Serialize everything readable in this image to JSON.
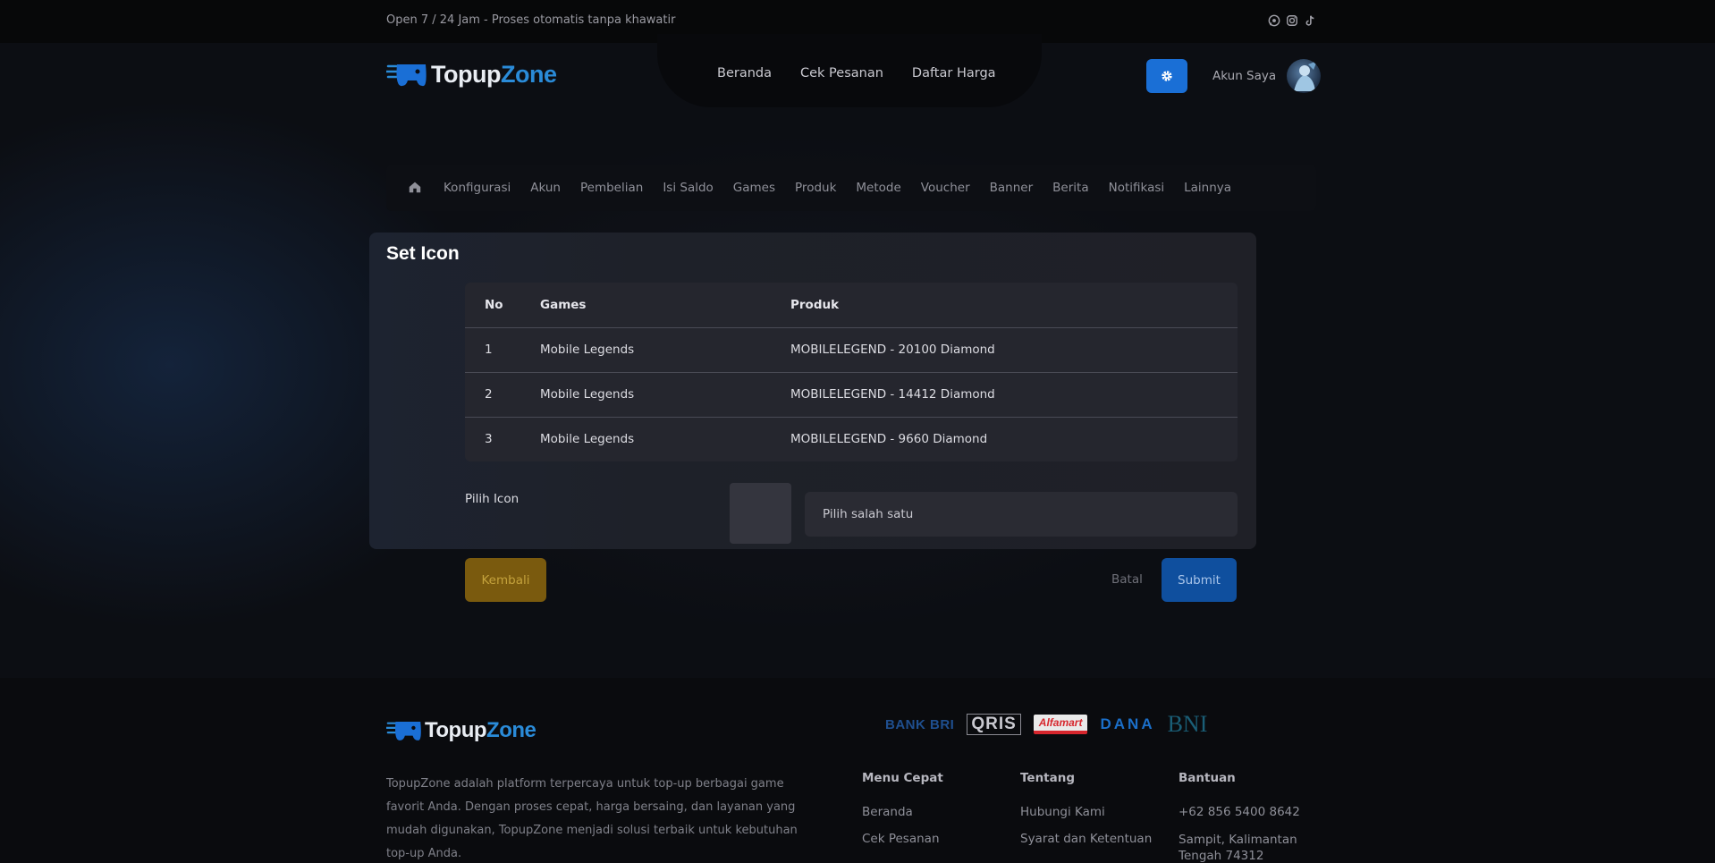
{
  "topbar": {
    "open_text": "Open 7 / 24 Jam - Proses otomatis tanpa khawatir",
    "social_icons": [
      "whatsapp-icon",
      "instagram-icon",
      "tiktok-icon"
    ]
  },
  "brand": {
    "part1": "Topup",
    "part2": "Zone"
  },
  "nav": {
    "items": [
      "Beranda",
      "Cek Pesanan",
      "Daftar Harga"
    ]
  },
  "account": {
    "label": "Akun Saya"
  },
  "menu": {
    "items": [
      "Konfigurasi",
      "Akun",
      "Pembelian",
      "Isi Saldo",
      "Games",
      "Produk",
      "Metode",
      "Voucher",
      "Banner",
      "Berita",
      "Notifikasi",
      "Lainnya"
    ]
  },
  "card": {
    "title": "Set Icon",
    "table": {
      "headers": [
        "No",
        "Games",
        "Produk"
      ],
      "rows": [
        [
          "1",
          "Mobile Legends",
          "MOBILELEGEND - 20100 Diamond"
        ],
        [
          "2",
          "Mobile Legends",
          "MOBILELEGEND - 14412 Diamond"
        ],
        [
          "3",
          "Mobile Legends",
          "MOBILELEGEND - 9660 Diamond"
        ]
      ]
    },
    "pick_label": "Pilih Icon",
    "select_value": "Pilih salah satu"
  },
  "actions": {
    "back": "Kembali",
    "cancel": "Batal",
    "submit": "Submit"
  },
  "footer": {
    "description": "TopupZone adalah platform terpercaya untuk top-up berbagai game favorit Anda. Dengan proses cepat, harga bersaing, dan layanan yang mudah digunakan, TopupZone menjadi solusi terbaik untuk kebutuhan top-up Anda.",
    "payments": {
      "bri": "BANK BRI",
      "qris": "QRIS",
      "alfa": "Alfamart",
      "dana": "DANA",
      "bni": "BNI"
    },
    "columns": [
      {
        "title": "Menu Cepat",
        "items": [
          "Beranda",
          "Cek Pesanan"
        ]
      },
      {
        "title": "Tentang",
        "items": [
          "Hubungi Kami",
          "Syarat dan Ketentuan"
        ]
      },
      {
        "title": "Bantuan",
        "items": [
          "+62 856 5400 8642",
          "Sampit, Kalimantan Tengah 74312"
        ]
      }
    ]
  },
  "colors": {
    "accent": "#1a6fd6",
    "warning": "#7a5a0e",
    "brand_blue": "#2a8bd8"
  }
}
